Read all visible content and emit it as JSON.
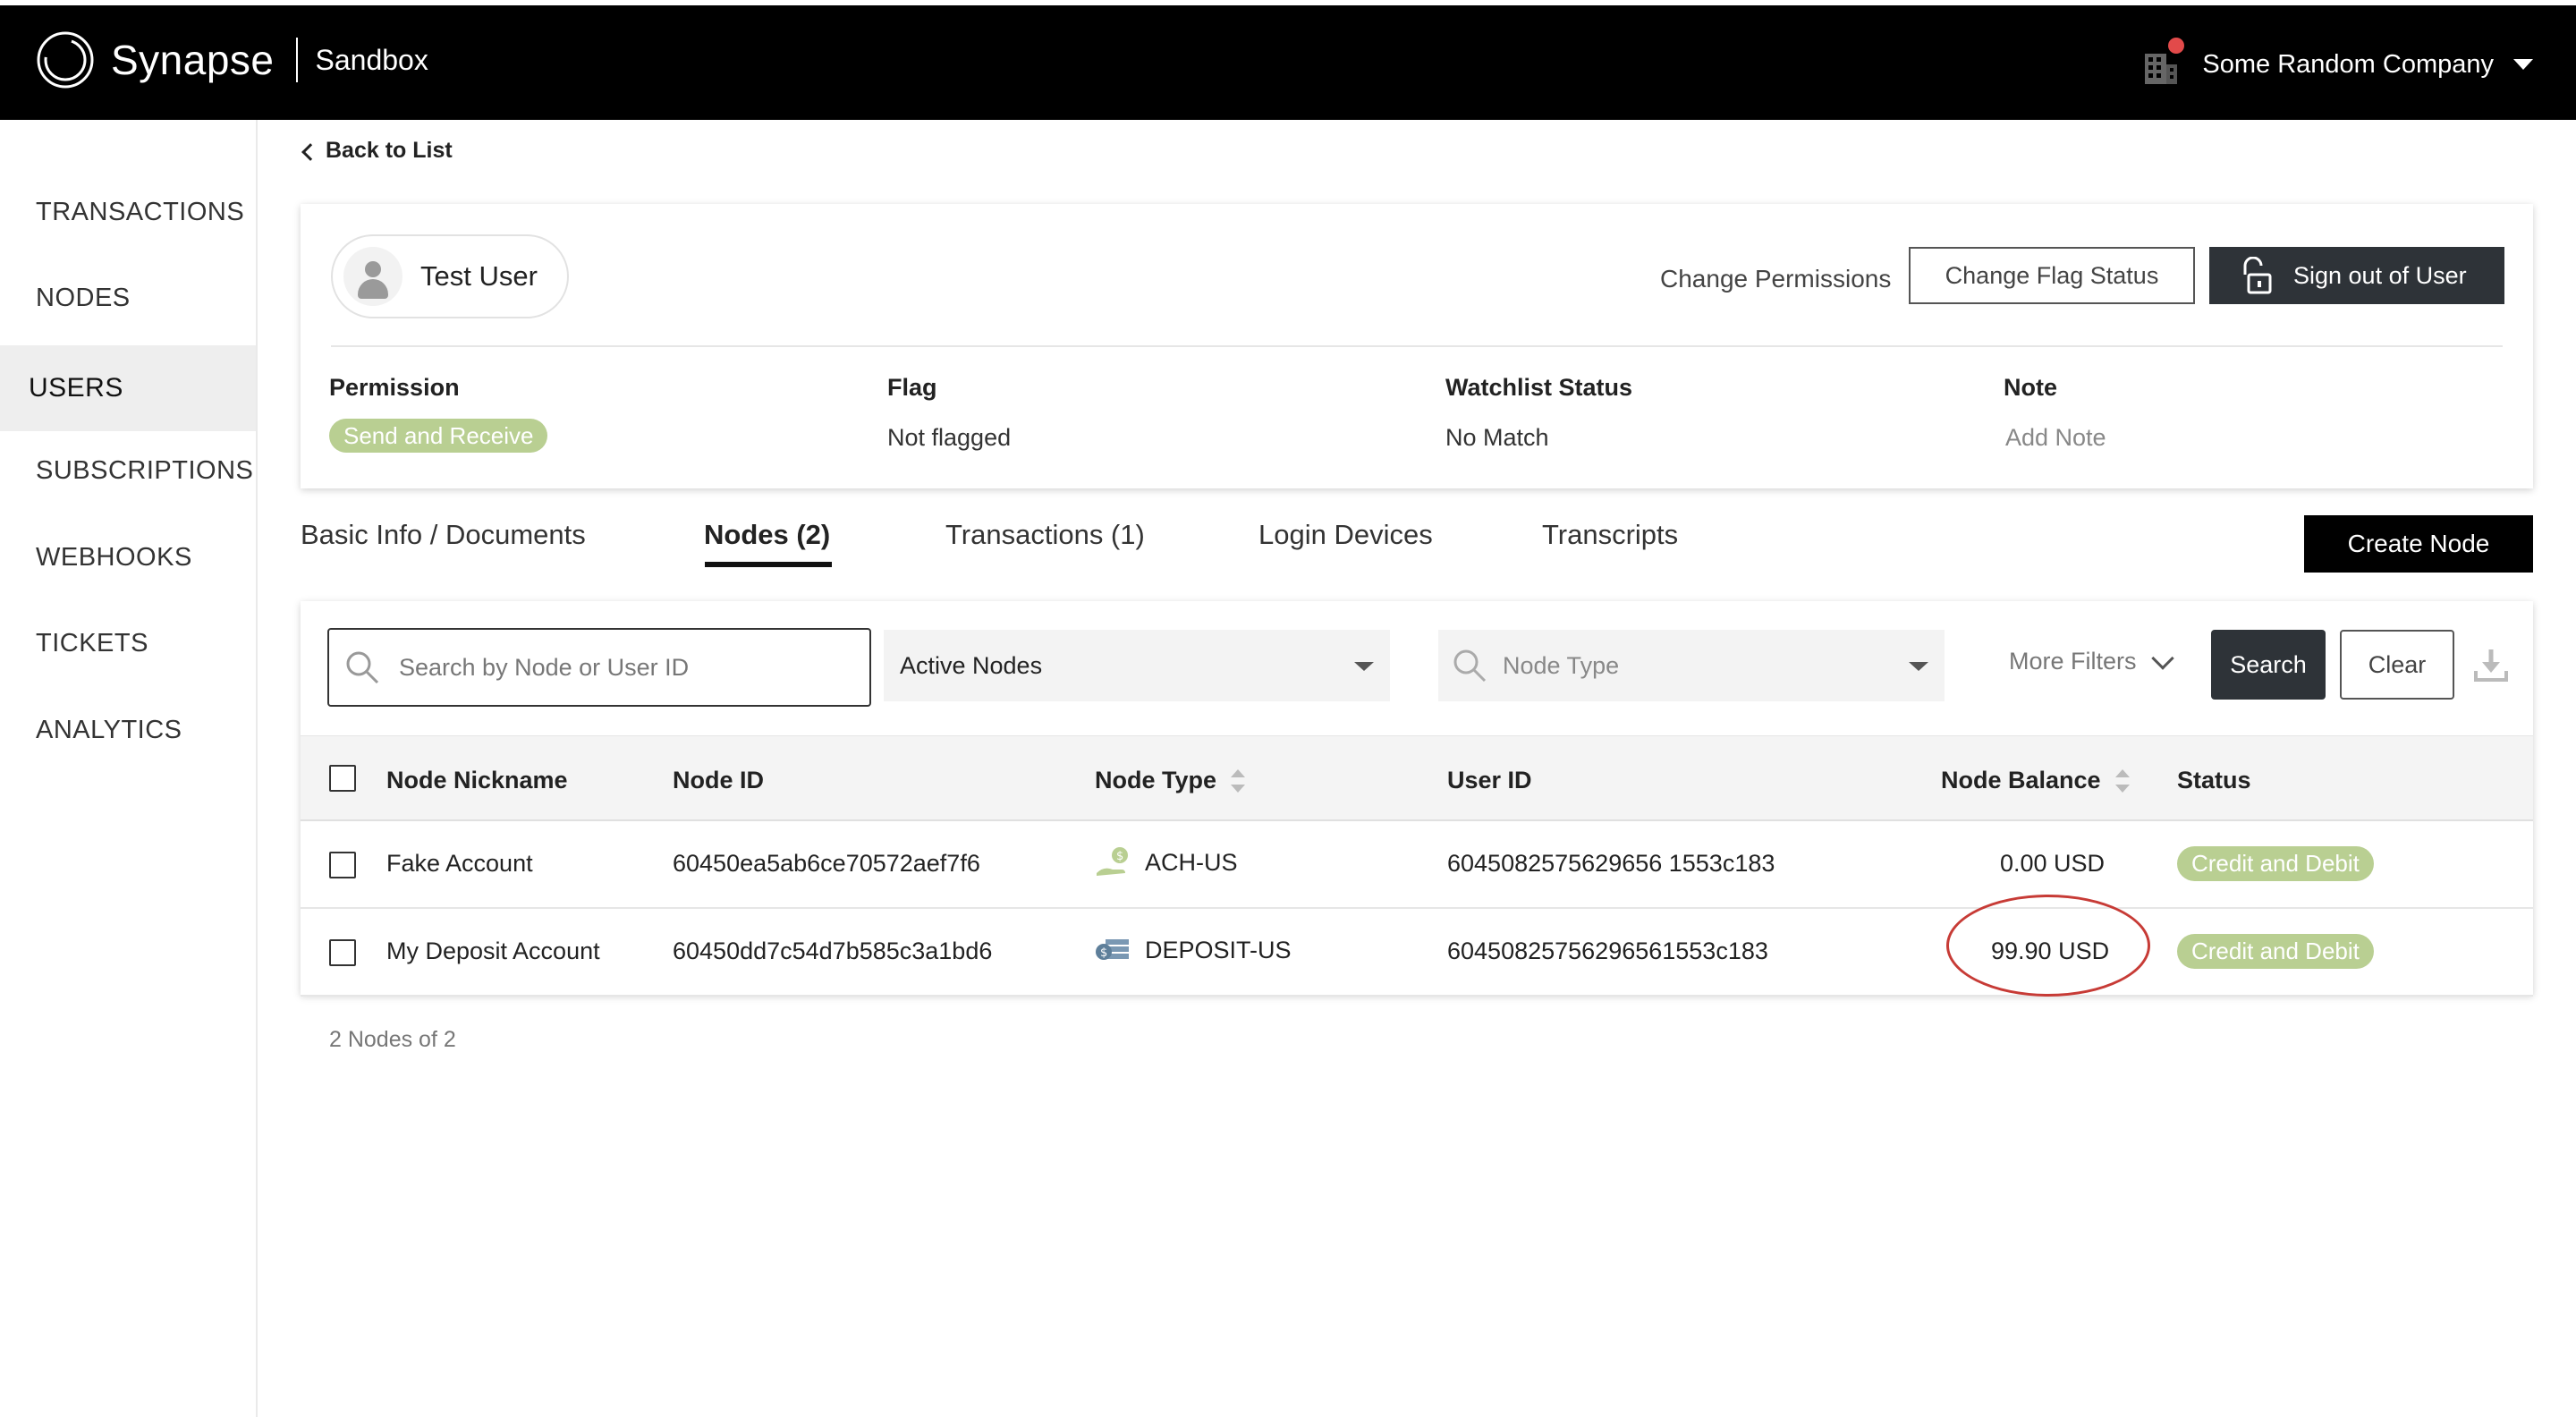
{
  "header": {
    "brand": "Synapse",
    "environment": "Sandbox",
    "company": "Some Random Company",
    "icons": [
      "synapse-logo",
      "building-icon",
      "notification-dot",
      "caret-down-icon"
    ]
  },
  "sidebar": {
    "items": [
      {
        "label": "TRANSACTIONS",
        "active": false
      },
      {
        "label": "NODES",
        "active": false
      },
      {
        "label": "USERS",
        "active": true
      },
      {
        "label": "SUBSCRIPTIONS",
        "active": false
      },
      {
        "label": "WEBHOOKS",
        "active": false
      },
      {
        "label": "TICKETS",
        "active": false
      },
      {
        "label": "ANALYTICS",
        "active": false
      }
    ]
  },
  "nav": {
    "back_label": "Back to List"
  },
  "user": {
    "name": "Test User",
    "change_permissions": "Change Permissions",
    "change_flag": "Change Flag Status",
    "sign_out": "Sign out of User",
    "fields": {
      "permission_label": "Permission",
      "permission_value": "Send and Receive",
      "flag_label": "Flag",
      "flag_value": "Not flagged",
      "watchlist_label": "Watchlist Status",
      "watchlist_value": "No Match",
      "note_label": "Note",
      "note_value": "Add Note"
    }
  },
  "tabs": [
    {
      "label": "Basic Info / Documents",
      "active": false
    },
    {
      "label": "Nodes (2)",
      "active": true
    },
    {
      "label": "Transactions (1)",
      "active": false
    },
    {
      "label": "Login Devices",
      "active": false
    },
    {
      "label": "Transcripts",
      "active": false
    }
  ],
  "create_node": "Create Node",
  "filters": {
    "search_placeholder": "Search by Node or User ID",
    "status_select": "Active Nodes",
    "type_placeholder": "Node Type",
    "more_filters": "More Filters",
    "search_button": "Search",
    "clear_button": "Clear"
  },
  "table": {
    "columns": [
      "Node Nickname",
      "Node ID",
      "Node Type",
      "User ID",
      "Node Balance",
      "Status"
    ],
    "rows": [
      {
        "nickname": "Fake Account",
        "node_id": "60450ea5ab6ce70572aef7f6",
        "node_type": "ACH-US",
        "user_id": "6045082575629656 1553c183",
        "balance": "0.00 USD",
        "status": "Credit and Debit"
      },
      {
        "nickname": "My Deposit Account",
        "node_id": "60450dd7c54d7b585c3a1bd6",
        "node_type": "DEPOSIT-US",
        "user_id": "60450825756296561553c183",
        "balance": "99.90 USD",
        "status": "Credit and Debit"
      }
    ],
    "count_text": "2 Nodes of 2"
  },
  "colors": {
    "topbar": "#000000",
    "dark_button": "#2e3338",
    "status_green": "#b9cf92",
    "highlight_circle": "#c73b36"
  }
}
